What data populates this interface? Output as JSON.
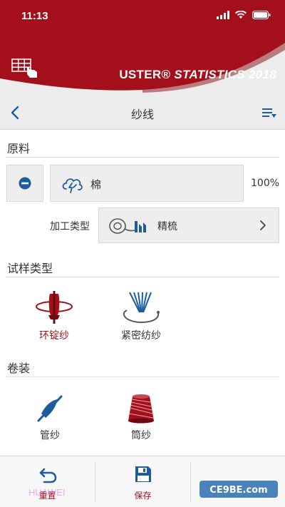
{
  "status_bar": {
    "time": "11:13"
  },
  "brand": {
    "title_prefix": "USTER® ",
    "title_main": "STATISTICS 2018"
  },
  "navbar": {
    "title": "纱线"
  },
  "raw_material": {
    "section_title": "原料",
    "material": "棉",
    "percentage": "100%",
    "process_label": "加工类型",
    "process_value": "精梳"
  },
  "sample_type": {
    "section_title": "试样类型",
    "options": [
      {
        "label": "环锭纱",
        "selected": true
      },
      {
        "label": "紧密纺纱",
        "selected": false
      }
    ]
  },
  "package": {
    "section_title": "卷装",
    "options": [
      {
        "label": "管纱"
      },
      {
        "label": "筒纱"
      }
    ]
  },
  "toolbar": {
    "reset_label": "重置",
    "save_label": "保存"
  },
  "watermark": {
    "text": "HUAWEI",
    "badge": "CE9BE.com"
  },
  "colors": {
    "brand_red": "#a30f1a",
    "accent_blue": "#1f5c9e",
    "nav_background": "#ececec"
  }
}
